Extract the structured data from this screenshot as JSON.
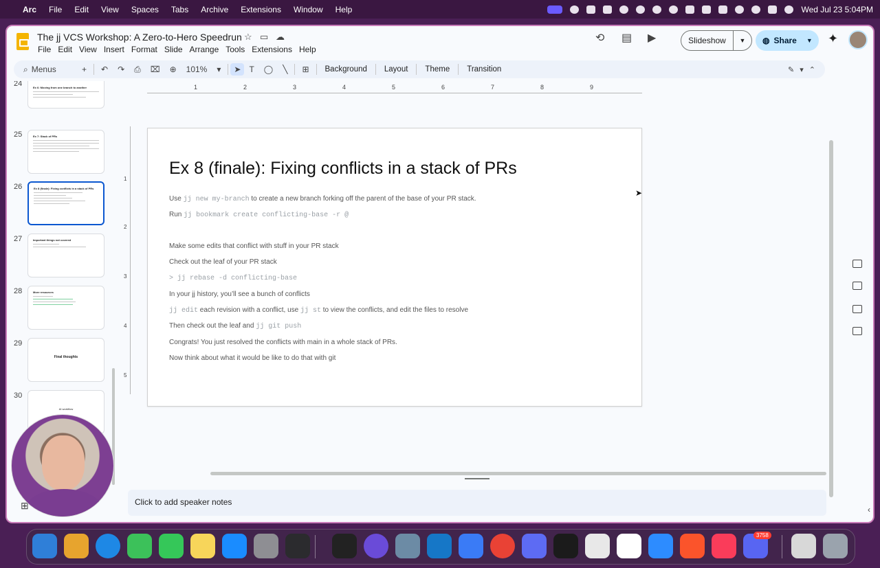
{
  "menubar": {
    "app": "Arc",
    "items": [
      "File",
      "Edit",
      "View",
      "Spaces",
      "Tabs",
      "Archive",
      "Extensions",
      "Window",
      "Help"
    ],
    "clock": "Wed Jul 23  5:04PM"
  },
  "doc": {
    "title": "The jj VCS Workshop: A Zero-to-Hero Speedrun",
    "menu": [
      "File",
      "Edit",
      "View",
      "Insert",
      "Format",
      "Slide",
      "Arrange",
      "Tools",
      "Extensions",
      "Help"
    ]
  },
  "header": {
    "slideshow_label": "Slideshow",
    "share_label": "Share"
  },
  "toolbar": {
    "menus_label": "Menus",
    "zoom": "101%",
    "background_label": "Background",
    "layout_label": "Layout",
    "theme_label": "Theme",
    "transition_label": "Transition"
  },
  "filmstrip": {
    "slides": [
      {
        "num": "24",
        "title": "Ex 6: Moving from one branch to another"
      },
      {
        "num": "25",
        "title": "Ex 7: Stack of PRs"
      },
      {
        "num": "26",
        "title": "Ex 8 (finale): Fixing conflicts in a stack of PRs"
      },
      {
        "num": "27",
        "title": "Important things not covered"
      },
      {
        "num": "28",
        "title": "More resources"
      },
      {
        "num": "29",
        "title": "Final thoughts"
      },
      {
        "num": "30",
        "title": "AI workflow"
      }
    ]
  },
  "ruler": {
    "h": [
      "1",
      "2",
      "3",
      "4",
      "5",
      "6",
      "7",
      "8",
      "9"
    ],
    "v": [
      "1",
      "2",
      "3",
      "4",
      "5"
    ]
  },
  "slide": {
    "title": "Ex 8 (finale): Fixing conflicts in a stack of PRs",
    "l1a": "Use ",
    "l1code": "jj new my-branch",
    "l1b": " to create a new branch forking off the parent of the base of your PR stack.",
    "l2a": "Run ",
    "l2code": "jj bookmark create conflicting-base -r @",
    "l3": "Make some edits that conflict with stuff in your PR stack",
    "l4": "Check out the leaf of your PR stack",
    "l5code": "> jj rebase -d conflicting-base",
    "l6": "In your jj history, you’ll see a bunch of conflicts",
    "l7code1": "jj edit",
    "l7a": " each revision with a conflict, use ",
    "l7code2": "jj st",
    "l7b": " to view the conflicts, and edit the files to resolve",
    "l8a": "Then check out the leaf and ",
    "l8code": "jj git push",
    "l9": "Congrats! You just resolved the conflicts with main in a whole stack of PRs.",
    "l10": "Now think about what it would be like to do that with git"
  },
  "notes": {
    "placeholder": "Click to add speaker notes"
  },
  "dock": {
    "badge": "3758"
  }
}
